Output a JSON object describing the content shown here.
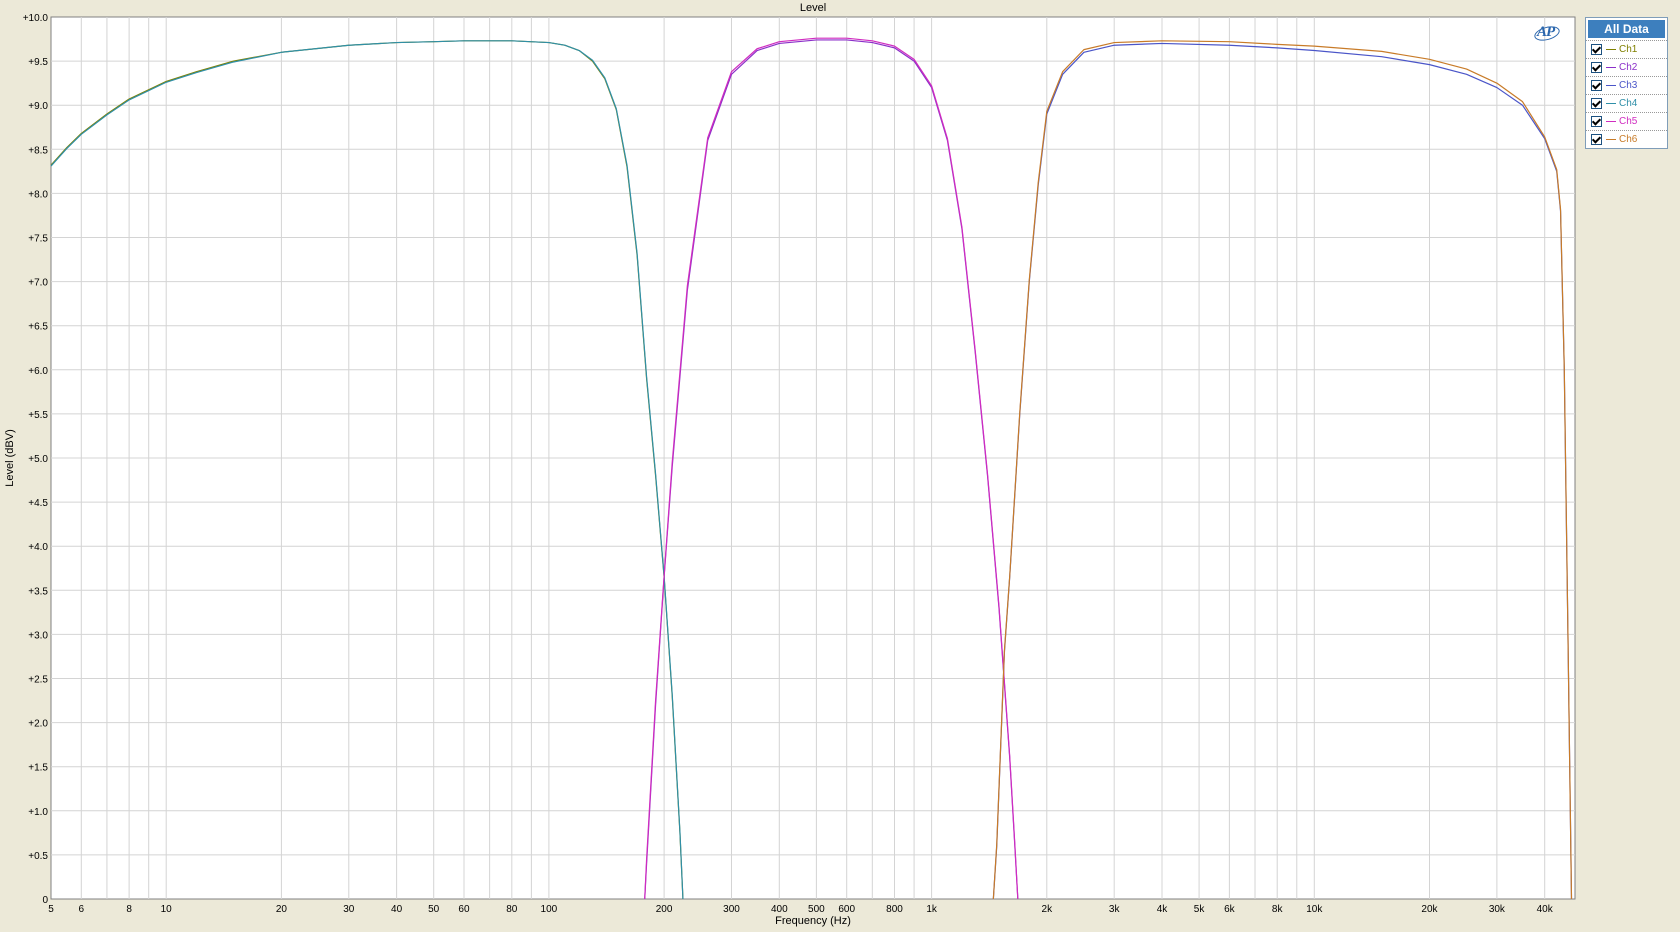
{
  "chart_data": {
    "type": "line",
    "title": "Level",
    "xlabel": "Frequency (Hz)",
    "ylabel": "Level (dBV)",
    "xscale": "log",
    "xlim": [
      5,
      48000
    ],
    "ylim": [
      0,
      10
    ],
    "grid": true,
    "legend_position": "right",
    "x_ticks": [
      {
        "value": 5,
        "label": "5"
      },
      {
        "value": 6,
        "label": "6"
      },
      {
        "value": 8,
        "label": "8"
      },
      {
        "value": 10,
        "label": "10"
      },
      {
        "value": 20,
        "label": "20"
      },
      {
        "value": 30,
        "label": "30"
      },
      {
        "value": 40,
        "label": "40"
      },
      {
        "value": 50,
        "label": "50"
      },
      {
        "value": 60,
        "label": "60"
      },
      {
        "value": 80,
        "label": "80"
      },
      {
        "value": 100,
        "label": "100"
      },
      {
        "value": 200,
        "label": "200"
      },
      {
        "value": 300,
        "label": "300"
      },
      {
        "value": 400,
        "label": "400"
      },
      {
        "value": 500,
        "label": "500"
      },
      {
        "value": 600,
        "label": "600"
      },
      {
        "value": 800,
        "label": "800"
      },
      {
        "value": 1000,
        "label": "1k"
      },
      {
        "value": 2000,
        "label": "2k"
      },
      {
        "value": 3000,
        "label": "3k"
      },
      {
        "value": 4000,
        "label": "4k"
      },
      {
        "value": 5000,
        "label": "5k"
      },
      {
        "value": 6000,
        "label": "6k"
      },
      {
        "value": 8000,
        "label": "8k"
      },
      {
        "value": 10000,
        "label": "10k"
      },
      {
        "value": 20000,
        "label": "20k"
      },
      {
        "value": 30000,
        "label": "30k"
      },
      {
        "value": 40000,
        "label": "40k"
      }
    ],
    "x_minor": [
      7,
      9,
      70,
      90,
      700,
      900,
      7000,
      9000
    ],
    "y_ticks": [
      {
        "value": 0,
        "label": "0"
      },
      {
        "value": 0.5,
        "label": "+0.5"
      },
      {
        "value": 1.0,
        "label": "+1.0"
      },
      {
        "value": 1.5,
        "label": "+1.5"
      },
      {
        "value": 2.0,
        "label": "+2.0"
      },
      {
        "value": 2.5,
        "label": "+2.5"
      },
      {
        "value": 3.0,
        "label": "+3.0"
      },
      {
        "value": 3.5,
        "label": "+3.5"
      },
      {
        "value": 4.0,
        "label": "+4.0"
      },
      {
        "value": 4.5,
        "label": "+4.5"
      },
      {
        "value": 5.0,
        "label": "+5.0"
      },
      {
        "value": 5.5,
        "label": "+5.5"
      },
      {
        "value": 6.0,
        "label": "+6.0"
      },
      {
        "value": 6.5,
        "label": "+6.5"
      },
      {
        "value": 7.0,
        "label": "+7.0"
      },
      {
        "value": 7.5,
        "label": "+7.5"
      },
      {
        "value": 8.0,
        "label": "+8.0"
      },
      {
        "value": 8.5,
        "label": "+8.5"
      },
      {
        "value": 9.0,
        "label": "+9.0"
      },
      {
        "value": 9.5,
        "label": "+9.5"
      },
      {
        "value": 10.0,
        "label": "+10.0"
      }
    ],
    "series": [
      {
        "name": "Ch1",
        "color": "#808000",
        "x": [
          5,
          5.5,
          6,
          7,
          8,
          10,
          12,
          15,
          20,
          30,
          40,
          50,
          60,
          80,
          100,
          110,
          120,
          130,
          140,
          150,
          160,
          170,
          180,
          190,
          200,
          210,
          220,
          224
        ],
        "y": [
          8.32,
          8.52,
          8.68,
          8.9,
          9.07,
          9.27,
          9.38,
          9.5,
          9.6,
          9.68,
          9.71,
          9.72,
          9.73,
          9.73,
          9.71,
          9.68,
          9.62,
          9.5,
          9.3,
          8.95,
          8.3,
          7.3,
          5.9,
          4.8,
          3.65,
          2.3,
          0.75,
          0.0
        ]
      },
      {
        "name": "Ch2",
        "color": "#8b2fc9",
        "x": [
          178,
          180,
          190,
          200,
          210,
          230,
          260,
          300,
          350,
          400,
          500,
          600,
          700,
          800,
          900,
          1000,
          1100,
          1200,
          1300,
          1400,
          1500,
          1600,
          1650,
          1680
        ],
        "y": [
          0.0,
          0.4,
          2.2,
          3.65,
          4.9,
          6.9,
          8.6,
          9.35,
          9.62,
          9.7,
          9.74,
          9.74,
          9.71,
          9.65,
          9.5,
          9.2,
          8.6,
          7.6,
          6.2,
          4.8,
          3.3,
          1.6,
          0.6,
          0.0
        ]
      },
      {
        "name": "Ch3",
        "color": "#4a55c8",
        "x": [
          1450,
          1480,
          1550,
          1600,
          1700,
          1800,
          1900,
          2000,
          2200,
          2500,
          3000,
          4000,
          6000,
          8000,
          10000,
          15000,
          20000,
          25000,
          30000,
          35000,
          40000,
          43000,
          44000,
          45000,
          46000,
          47000
        ],
        "y": [
          0.0,
          0.6,
          2.8,
          3.65,
          5.5,
          7.0,
          8.1,
          8.9,
          9.35,
          9.6,
          9.68,
          9.7,
          9.68,
          9.65,
          9.62,
          9.55,
          9.46,
          9.35,
          9.2,
          9.0,
          8.62,
          8.25,
          7.8,
          6.0,
          3.0,
          0.0
        ]
      },
      {
        "name": "Ch4",
        "color": "#2f8fa8",
        "x": [
          5,
          5.5,
          6,
          7,
          8,
          10,
          12,
          15,
          20,
          30,
          40,
          50,
          60,
          80,
          100,
          110,
          120,
          130,
          140,
          150,
          160,
          170,
          180,
          190,
          200,
          210,
          220,
          224
        ],
        "y": [
          8.31,
          8.51,
          8.67,
          8.89,
          9.06,
          9.26,
          9.37,
          9.49,
          9.6,
          9.68,
          9.71,
          9.72,
          9.73,
          9.73,
          9.71,
          9.68,
          9.62,
          9.51,
          9.31,
          8.96,
          8.32,
          7.32,
          5.92,
          4.82,
          3.66,
          2.32,
          0.76,
          0.0
        ]
      },
      {
        "name": "Ch5",
        "color": "#d02cc0",
        "x": [
          178,
          180,
          190,
          200,
          210,
          230,
          260,
          300,
          350,
          400,
          500,
          600,
          700,
          800,
          900,
          1000,
          1100,
          1200,
          1300,
          1400,
          1500,
          1600,
          1650,
          1680
        ],
        "y": [
          0.0,
          0.45,
          2.25,
          3.66,
          4.95,
          6.95,
          8.63,
          9.38,
          9.64,
          9.72,
          9.76,
          9.76,
          9.73,
          9.67,
          9.52,
          9.22,
          8.62,
          7.62,
          6.22,
          4.82,
          3.32,
          1.62,
          0.62,
          0.0
        ]
      },
      {
        "name": "Ch6",
        "color": "#c87b28",
        "x": [
          1450,
          1480,
          1550,
          1600,
          1700,
          1800,
          1900,
          2000,
          2200,
          2500,
          3000,
          4000,
          6000,
          8000,
          10000,
          15000,
          20000,
          25000,
          30000,
          35000,
          40000,
          43000,
          44000,
          45000,
          46000,
          47000
        ],
        "y": [
          0.0,
          0.62,
          2.82,
          3.66,
          5.52,
          7.02,
          8.13,
          8.93,
          9.38,
          9.63,
          9.71,
          9.73,
          9.72,
          9.69,
          9.67,
          9.61,
          9.52,
          9.41,
          9.25,
          9.04,
          8.64,
          8.27,
          7.82,
          6.02,
          3.02,
          0.0
        ]
      }
    ]
  },
  "legend": {
    "header": "All Data",
    "items": [
      "Ch1",
      "Ch2",
      "Ch3",
      "Ch4",
      "Ch5",
      "Ch6"
    ]
  },
  "logo": {
    "text": "AP"
  }
}
